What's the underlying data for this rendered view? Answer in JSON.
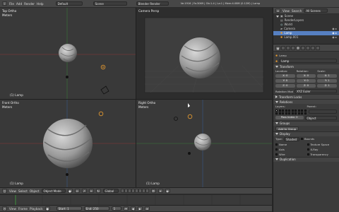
{
  "info_header": {
    "menus": [
      "File",
      "Add",
      "Render",
      "Help"
    ],
    "screen": "Default",
    "scene": "Scene",
    "engine": "Blender Render",
    "stats": "Ve:1916 | Fa:3069 | Ob:1-4 | La:1 | Mem:4.08M (0.12M) | Lamp"
  },
  "viewports": {
    "top_left": {
      "title": "Top Ortho",
      "unit": "Meters",
      "footer": "(1) Lamp"
    },
    "top_right": {
      "title": "Camera Persp"
    },
    "bottom_left": {
      "title": "Front Ortho",
      "unit": "Meters",
      "footer": "(1) Lamp"
    },
    "bottom_right": {
      "title": "Right Ortho",
      "unit": "Meters",
      "footer": "(1) Lamp"
    }
  },
  "view_header": {
    "menus": [
      "View",
      "Select",
      "Object"
    ],
    "mode": "Object Mode",
    "pivot": "Global"
  },
  "outliner": {
    "view_menus": [
      "View",
      "Search"
    ],
    "filter": "All Scenes",
    "items": [
      {
        "label": "Scene",
        "icon": "scene-icon"
      },
      {
        "label": "RenderLayers",
        "icon": "renderlayers-icon"
      },
      {
        "label": "World",
        "icon": "world-icon"
      },
      {
        "label": "Camera",
        "icon": "camera-icon"
      },
      {
        "label": "Lamp",
        "icon": "lamp-icon"
      },
      {
        "label": "Lamp.001",
        "icon": "lamp-icon"
      }
    ]
  },
  "properties": {
    "breadcrumb": "Lamp",
    "name_value": "Lamp",
    "transform": {
      "title": "Transform",
      "location_label": "Location:",
      "rotation_label": "Rotation:",
      "scale_label": "Scale:",
      "location": [
        "X: 0",
        "Y: 0",
        "Z: 0"
      ],
      "rotation": [
        "X: 0",
        "Y: 0",
        "Z: 0"
      ],
      "scale": [
        "X: 1",
        "Y: 1",
        "Z: 1"
      ],
      "rotation_mode_label": "Rotation Mod",
      "rotation_mode": "XYZ Euler"
    },
    "delta_title": "Transform Locks",
    "relations": {
      "title": "Relations",
      "layers_label": "Layers:",
      "parent_label": "Parent:",
      "pass_index": "Pass Index: 0",
      "parent_type": "Object"
    },
    "groups": {
      "title": "Groups",
      "add_button": "Add to Group"
    },
    "display": {
      "title": "Display",
      "type_label": "Type:",
      "type_value": "Shaded",
      "bounds": "Bounds",
      "checks": [
        "Name",
        "Axis",
        "Wire",
        "Texture Space",
        "X-Ray",
        "Transparency"
      ]
    },
    "duplication_title": "Duplication"
  },
  "timeline": {
    "menus": [
      "View",
      "Frame",
      "Playback"
    ],
    "start": "Start: 1",
    "end": "End: 250",
    "current": "1"
  },
  "colors": {
    "lamp_orange": "#f0a030",
    "x_axis": "#a33b3b",
    "y_axis": "#3f8a3f",
    "selection": "#f0a030"
  }
}
